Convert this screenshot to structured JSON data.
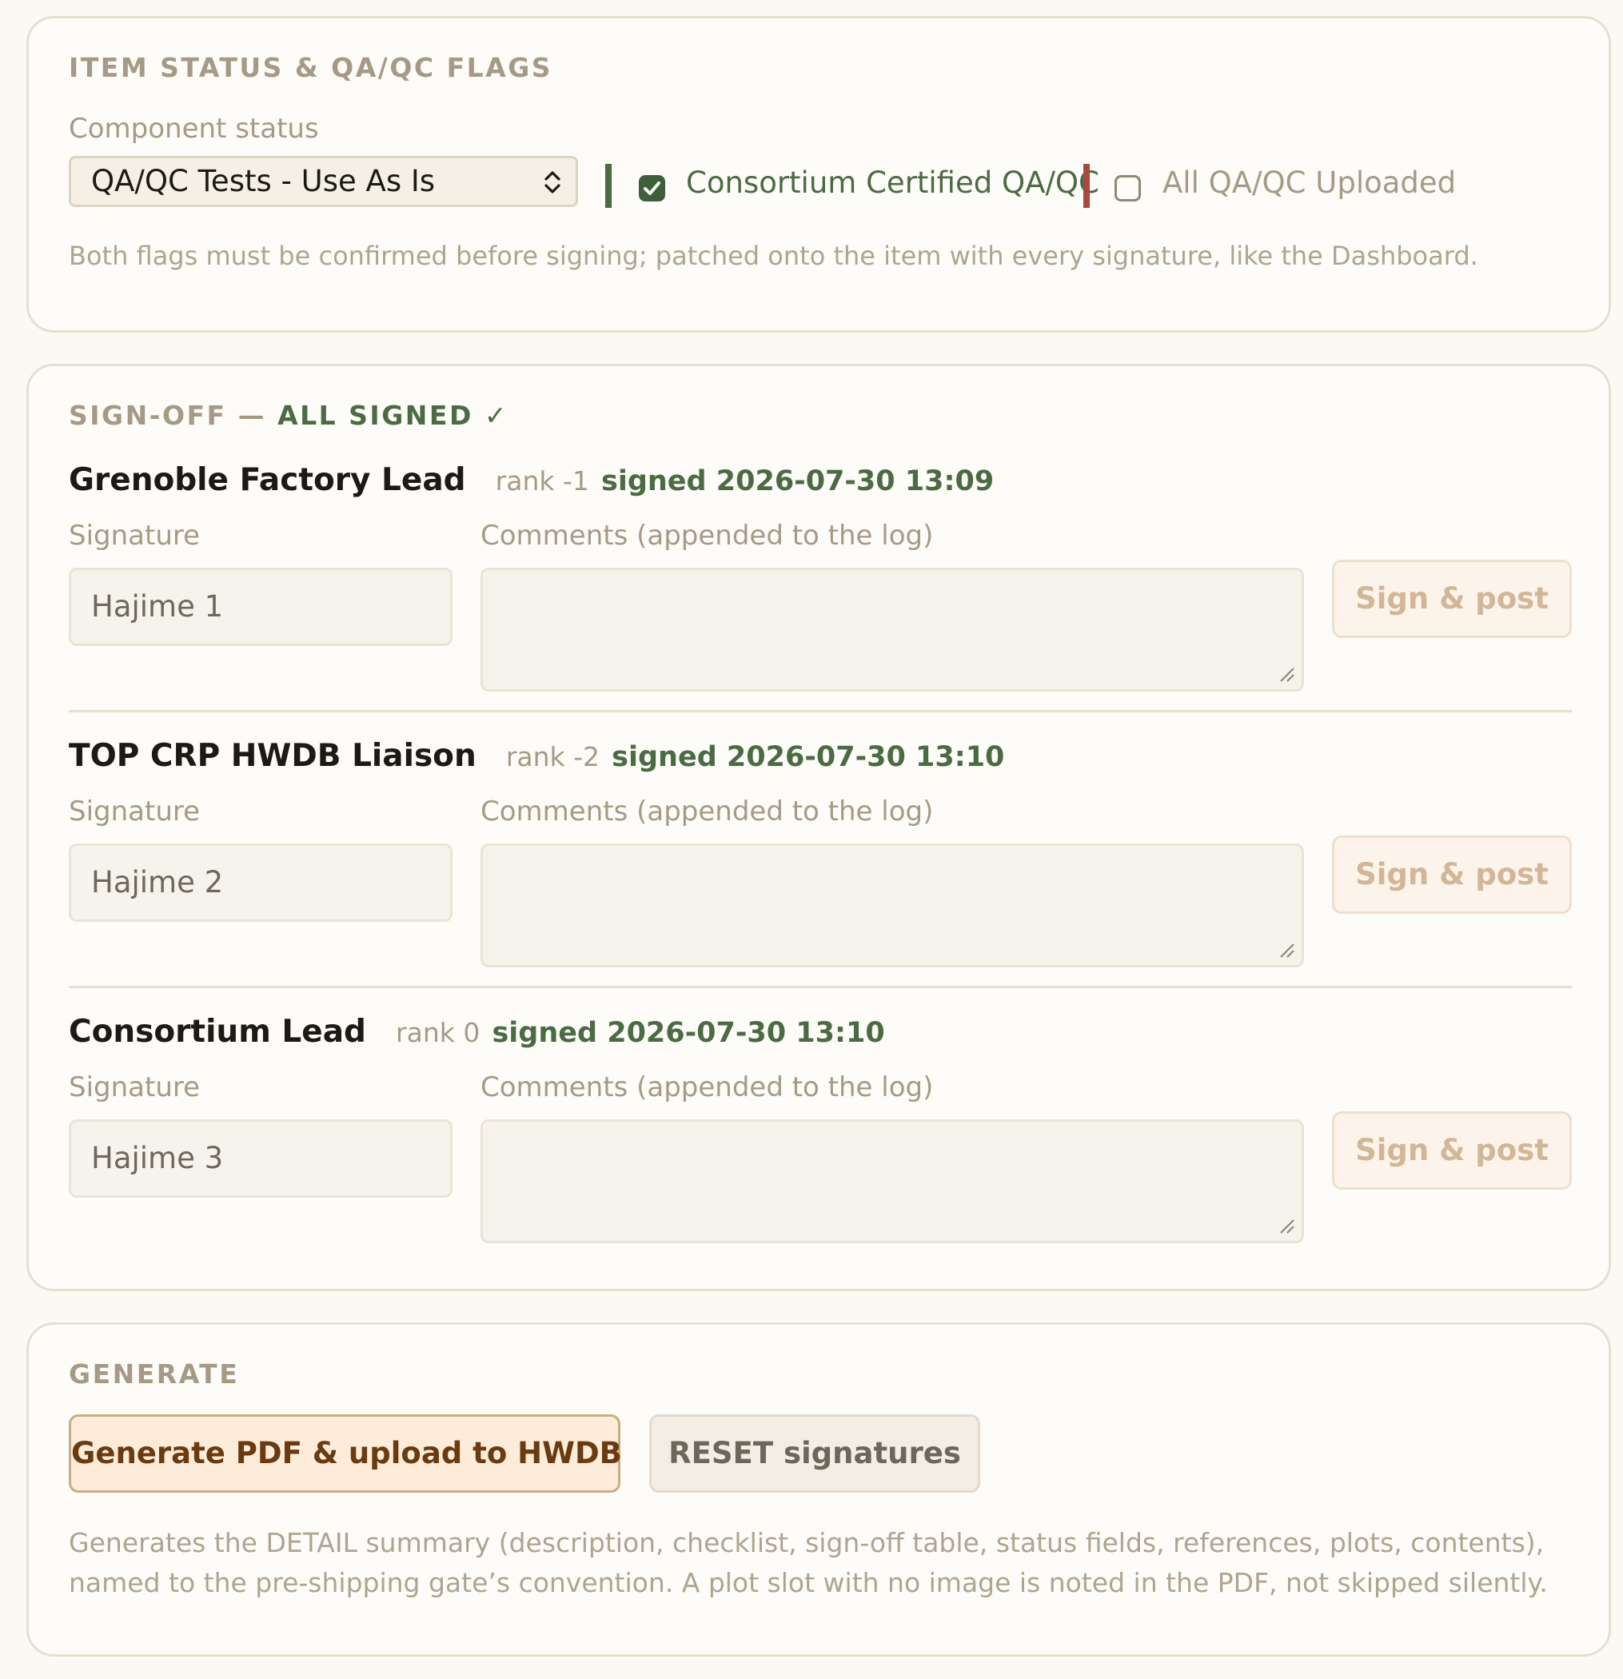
{
  "status_card": {
    "title": "ITEM STATUS & QA/QC FLAGS",
    "component_status_label": "Component status",
    "component_status_value": "QA/QC Tests - Use As Is",
    "flags": [
      {
        "label": "Consortium Certified QA/QC",
        "checked": true,
        "bar_color": "#4b6b43"
      },
      {
        "label": "All QA/QC Uploaded",
        "checked": false,
        "bar_color": "#a94840"
      }
    ],
    "help": "Both flags must be confirmed before signing; patched onto the item with every signature, like the Dashboard."
  },
  "signoff_card": {
    "title_prefix": "SIGN-OFF — ",
    "title_status": "ALL SIGNED ✓",
    "signature_label": "Signature",
    "comments_label": "Comments (appended to the log)",
    "sign_button_label": "Sign & post",
    "rows": [
      {
        "role": "Grenoble Factory Lead",
        "rank": "rank -1",
        "signed": "signed 2026-07-30 13:09",
        "signature": "Hajime 1"
      },
      {
        "role": "TOP CRP HWDB Liaison",
        "rank": "rank -2",
        "signed": "signed 2026-07-30 13:10",
        "signature": "Hajime 2"
      },
      {
        "role": "Consortium Lead",
        "rank": "rank 0",
        "signed": "signed 2026-07-30 13:10",
        "signature": "Hajime 3"
      }
    ]
  },
  "generate_card": {
    "title": "GENERATE",
    "generate_button": "Generate PDF & upload to HWDB",
    "reset_button": "RESET signatures",
    "help": "Generates the DETAIL summary (description, checklist, sign-off table, status fields, references, plots, contents), named to the pre-shipping gate’s convention. A plot slot with no image is noted in the PDF, not skipped silently."
  },
  "colors": {
    "accent_green": "#4b6b43",
    "flag_red": "#a94840",
    "muted": "#a69a86"
  }
}
